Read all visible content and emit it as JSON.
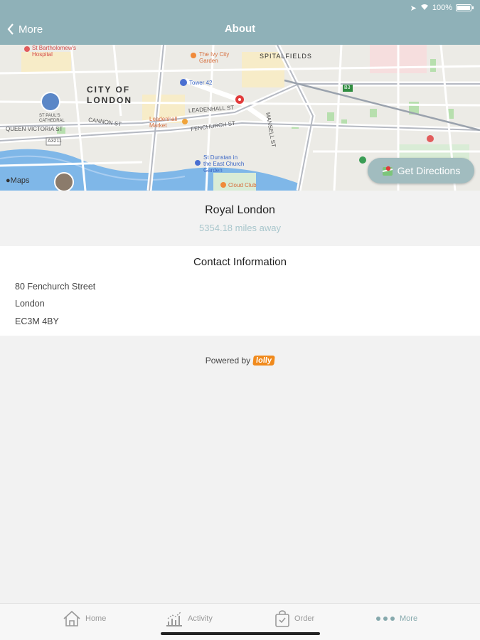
{
  "status_bar": {
    "battery": "100%"
  },
  "nav": {
    "back_label": "More",
    "title": "About"
  },
  "map": {
    "labels": {
      "city": "CITY OF LONDON",
      "spitalfields": "SPITALFIELDS",
      "barts": "St Bartholomew's Hospital",
      "garden": "The Ivy City Garden",
      "tower42": "Tower 42",
      "leadenhall_st": "LEADENHALL ST",
      "fenchurch_st": "FENCHURCH ST",
      "cannon_st": "CANNON ST",
      "victoria_st": "QUEEN VICTORIA ST",
      "stpauls": "ST PAUL'S CATHEDRAL",
      "market": "Leadenhall Market",
      "dunstan": "St Dunstan in the East Church Garden",
      "cloud": "Cloud Club",
      "a3211": "A3211",
      "mansell": "MANSELL ST",
      "b3": "B3"
    },
    "attribution": "Maps",
    "directions_label": "Get Directions"
  },
  "location": {
    "name": "Royal London",
    "distance": "5354.18 miles away"
  },
  "contact": {
    "title": "Contact Information",
    "address_line1": "80 Fenchurch Street",
    "address_line2": "London",
    "address_line3": "EC3M 4BY"
  },
  "footer": {
    "powered_by": "Powered by",
    "brand": "lolly"
  },
  "tabs": [
    {
      "label": "Home",
      "icon": "home-icon"
    },
    {
      "label": "Activity",
      "icon": "activity-icon"
    },
    {
      "label": "Order",
      "icon": "bag-icon"
    },
    {
      "label": "More",
      "icon": "more-icon"
    }
  ],
  "colors": {
    "nav_bar": "#8fb1b8",
    "accent": "#86a9ad",
    "distance_text": "#a8c6cc",
    "brand": "#f08a1d"
  }
}
